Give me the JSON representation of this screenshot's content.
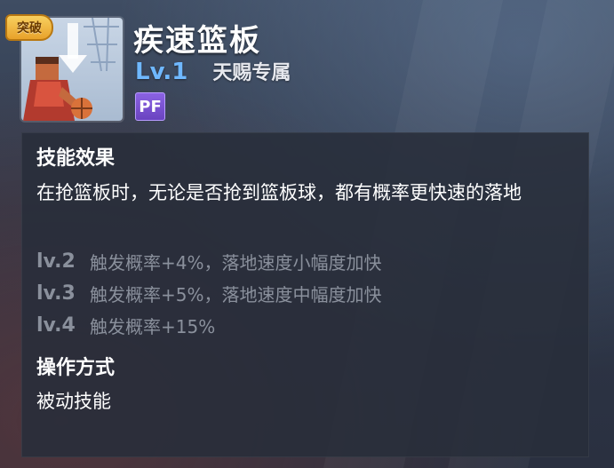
{
  "header": {
    "badge": "突破",
    "skill_name": "疾速篮板",
    "level": "Lv.1",
    "exclusive": "天赐专属",
    "position": "PF"
  },
  "panel": {
    "effect_title": "技能效果",
    "effect_desc": "在抢篮板时，无论是否抢到篮板球，都有概率更快速的落地",
    "levels": [
      {
        "tag": "lv.2",
        "desc": "触发概率+4%，落地速度小幅度加快"
      },
      {
        "tag": "lv.3",
        "desc": "触发概率+5%，落地速度中幅度加快"
      },
      {
        "tag": "lv.4",
        "desc": "触发概率+15%"
      }
    ],
    "operation_title": "操作方式",
    "operation_desc": "被动技能"
  }
}
